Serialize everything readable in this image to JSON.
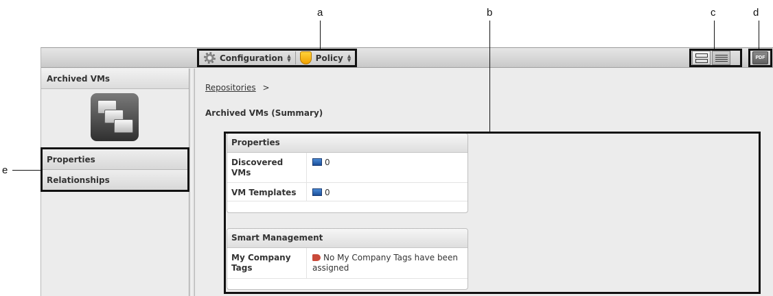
{
  "callouts": {
    "a": "a",
    "b": "b",
    "c": "c",
    "d": "d",
    "e": "e"
  },
  "toolbar": {
    "configuration_label": "Configuration",
    "policy_label": "Policy",
    "pdf_label": "PDF",
    "icons": [
      "gear-icon",
      "shield-icon",
      "tile-view-icon",
      "list-view-icon",
      "pdf-icon"
    ]
  },
  "sidebar": {
    "header": "Archived VMs",
    "icon": "archived-vms-folders-icon",
    "items": [
      {
        "label": "Properties"
      },
      {
        "label": "Relationships"
      }
    ]
  },
  "main": {
    "breadcrumb_link": "Repositories",
    "breadcrumb_sep": ">",
    "title": "Archived VMs (Summary)",
    "properties": {
      "title": "Properties",
      "rows": [
        {
          "label": "Discovered VMs",
          "value": "0",
          "icon": "vm-icon"
        },
        {
          "label": "VM Templates",
          "value": "0",
          "icon": "vm-icon"
        }
      ]
    },
    "smart_management": {
      "title": "Smart Management",
      "rows": [
        {
          "label": "My Company Tags",
          "value": "No My Company Tags have been assigned",
          "icon": "tag-icon"
        }
      ]
    }
  },
  "colors": {
    "toolbar_top": "#e6e6e6",
    "toolbar_bottom": "#c9c9c9",
    "background": "#ececec",
    "callout": "#111111"
  }
}
